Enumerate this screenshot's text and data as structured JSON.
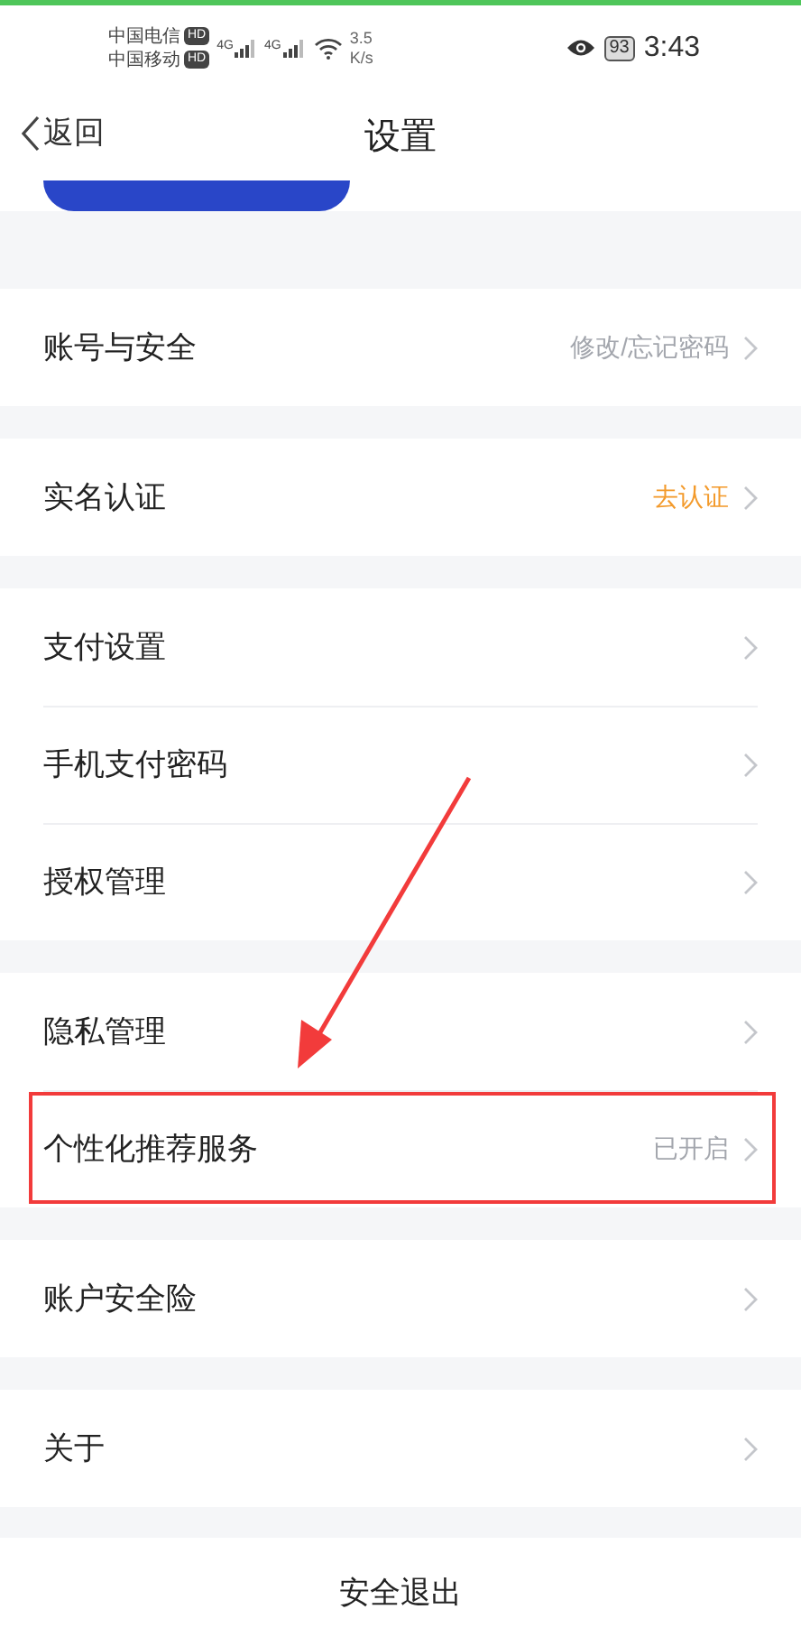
{
  "status_bar": {
    "carriers": [
      {
        "name": "中国电信",
        "badge": "HD"
      },
      {
        "name": "中国移动",
        "badge": "HD"
      }
    ],
    "networks": [
      "4G",
      "4G"
    ],
    "speed": [
      "3.5",
      "K/s"
    ],
    "battery": "93",
    "time": "3:43"
  },
  "nav": {
    "back": "返回",
    "title": "设置"
  },
  "sections": [
    {
      "rows": [
        {
          "label": "账号与安全",
          "value": "修改/忘记密码",
          "color": "#a3a6ad",
          "highlighted": false
        }
      ]
    },
    {
      "rows": [
        {
          "label": "实名认证",
          "value": "去认证",
          "color": "#f39a2b",
          "highlighted": false
        }
      ]
    },
    {
      "rows": [
        {
          "label": "支付设置",
          "highlighted": false
        },
        {
          "label": "手机支付密码",
          "highlighted": false
        },
        {
          "label": "授权管理",
          "highlighted": false
        }
      ]
    },
    {
      "rows": [
        {
          "label": "隐私管理",
          "highlighted": false
        },
        {
          "label": "个性化推荐服务",
          "value": "已开启",
          "color": "#a3a6ad",
          "highlighted": true
        }
      ]
    },
    {
      "rows": [
        {
          "label": "账户安全险",
          "highlighted": false
        }
      ]
    },
    {
      "rows": [
        {
          "label": "关于",
          "highlighted": false
        }
      ]
    }
  ],
  "logout": "安全退出"
}
